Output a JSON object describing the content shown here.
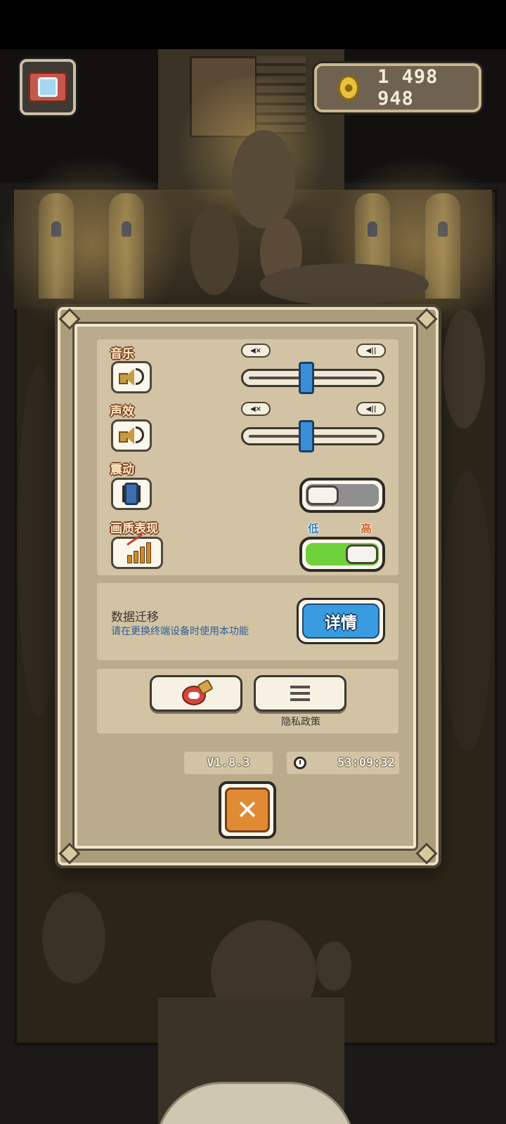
{
  "hud": {
    "camera_icon": "camera-icon",
    "coin_icon": "gold-coin-icon",
    "coins": "1 498 948"
  },
  "settings": {
    "music": {
      "label": "音乐",
      "icon": "speaker-icon",
      "mute_icon": "volume-mute-icon",
      "max_icon": "volume-max-icon",
      "level": 0.45
    },
    "sfx": {
      "label": "声效",
      "icon": "speaker-icon",
      "mute_icon": "volume-mute-icon",
      "max_icon": "volume-max-icon",
      "level": 0.45
    },
    "vibration": {
      "label": "震动",
      "icon": "vibrate-phone-icon",
      "enabled": false
    },
    "quality": {
      "label": "画质表现",
      "icon": "quality-chart-icon",
      "low_label": "低",
      "high_label": "高",
      "high": true
    }
  },
  "data_migration": {
    "title": "数据迁移",
    "subtitle": "请在更换终端设备时使用本功能",
    "button_label": "详情"
  },
  "links": {
    "community_icon": "community-icon",
    "privacy_icon": "list-icon",
    "privacy_label": "隐私政策"
  },
  "footer": {
    "version": "V1.8.3",
    "clock_icon": "clock-icon",
    "playtime": "53:09:32",
    "close_label": "✕"
  },
  "colors": {
    "slider_thumb": "#3a8fd8",
    "toggle_on": "#6fd13a",
    "details_button": "#3a9be0",
    "close_button": "#e08a34"
  }
}
